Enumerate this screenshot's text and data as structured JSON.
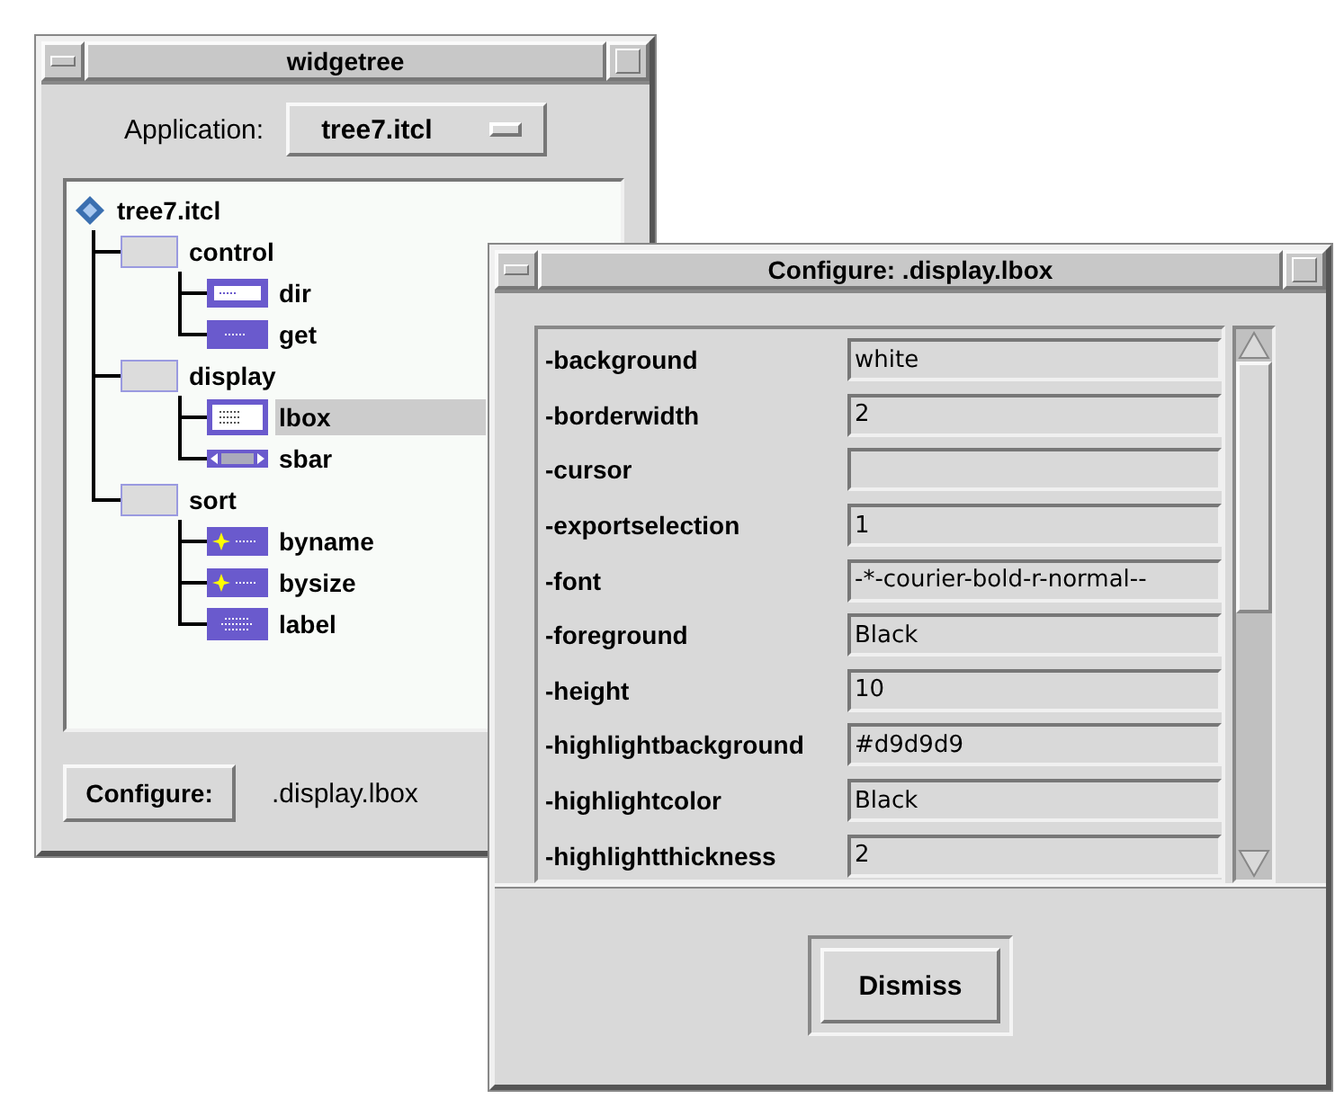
{
  "widgetree_window": {
    "title": "widgetree",
    "application_label": "Application:",
    "application_value": "tree7.itcl",
    "tree": [
      {
        "label": "tree7.itcl",
        "kind": "root",
        "selected": false,
        "children": [
          {
            "label": "control",
            "kind": "frame",
            "selected": false,
            "children": [
              {
                "label": "dir",
                "kind": "entry",
                "selected": false
              },
              {
                "label": "get",
                "kind": "button",
                "selected": false
              }
            ]
          },
          {
            "label": "display",
            "kind": "frame",
            "selected": false,
            "children": [
              {
                "label": "lbox",
                "kind": "listbox",
                "selected": true
              },
              {
                "label": "sbar",
                "kind": "scrollbar",
                "selected": false
              }
            ]
          },
          {
            "label": "sort",
            "kind": "frame",
            "selected": false,
            "children": [
              {
                "label": "byname",
                "kind": "radiobutton",
                "selected": false
              },
              {
                "label": "bysize",
                "kind": "radiobutton",
                "selected": false
              },
              {
                "label": "label",
                "kind": "label",
                "selected": false
              }
            ]
          }
        ]
      }
    ],
    "configure_button": "Configure:",
    "configure_target": ".display.lbox"
  },
  "configure_window": {
    "title": "Configure: .display.lbox",
    "options": [
      {
        "name": "-background",
        "value": "white"
      },
      {
        "name": "-borderwidth",
        "value": "2"
      },
      {
        "name": "-cursor"
      },
      {
        "name": "-exportselection",
        "value": "1"
      },
      {
        "name": "-font",
        "value": "-*-courier-bold-r-normal--"
      },
      {
        "name": "-foreground",
        "value": "Black"
      },
      {
        "name": "-height",
        "value": "10"
      },
      {
        "name": "-highlightbackground",
        "value": "#d9d9d9"
      },
      {
        "name": "-highlightcolor",
        "value": "Black"
      },
      {
        "name": "-highlightthickness",
        "value": "2"
      }
    ],
    "dismiss_button": "Dismiss"
  }
}
